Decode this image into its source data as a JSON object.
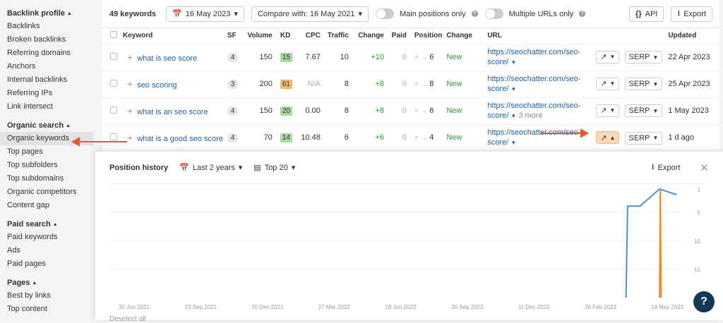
{
  "sidebar": {
    "sections": [
      {
        "title": "Backlink profile",
        "items": [
          "Backlinks",
          "Broken backlinks",
          "Referring domains",
          "Anchors",
          "Internal backlinks",
          "Referring IPs",
          "Link intersect"
        ]
      },
      {
        "title": "Organic search",
        "items": [
          "Organic keywords",
          "Top pages",
          "Top subfolders",
          "Top subdomains",
          "Organic competitors",
          "Content gap"
        ]
      },
      {
        "title": "Paid search",
        "items": [
          "Paid keywords",
          "Ads",
          "Paid pages"
        ]
      },
      {
        "title": "Pages",
        "items": [
          "Best by links",
          "Top content"
        ]
      }
    ],
    "active": "Organic keywords"
  },
  "toolbar": {
    "keyword_count": "49 keywords",
    "date": "16 May 2023",
    "compare": "Compare with: 16 May 2021",
    "main_positions_label": "Main positions only",
    "multiple_urls_label": "Multiple URLs only",
    "api_label": "API",
    "export_label": "Export"
  },
  "table": {
    "headers": {
      "keyword": "Keyword",
      "sf": "SF",
      "volume": "Volume",
      "kd": "KD",
      "cpc": "CPC",
      "traffic": "Traffic",
      "change": "Change",
      "paid": "Paid",
      "position": "Position",
      "change2": "Change",
      "url": "URL",
      "updated": "Updated"
    },
    "rows": [
      {
        "keyword": "what is seo score",
        "sf": "4",
        "volume": "150",
        "kd": "15",
        "kd_color": "green",
        "cpc": "7.67",
        "traffic": "10",
        "change": "+10",
        "paid": "0",
        "position": "6",
        "status": "New",
        "url": "https://seochatter.com/seo-score/",
        "more": "",
        "serp": "SERP",
        "updated": "22 Apr 2023"
      },
      {
        "keyword": "seo scoring",
        "sf": "3",
        "volume": "200",
        "kd": "61",
        "kd_color": "orange",
        "cpc": "N/A",
        "traffic": "8",
        "change": "+8",
        "paid": "0",
        "position": "8",
        "status": "New",
        "url": "https://seochatter.com/seo-score/",
        "more": "",
        "serp": "SERP",
        "updated": "25 Apr 2023"
      },
      {
        "keyword": "what is an seo score",
        "sf": "4",
        "volume": "150",
        "kd": "20",
        "kd_color": "green",
        "cpc": "0.00",
        "traffic": "8",
        "change": "+8",
        "paid": "0",
        "position": "6",
        "status": "New",
        "url": "https://seochatter.com/seo-score/",
        "more": "3 more",
        "serp": "SERP",
        "updated": "1 May 2023"
      },
      {
        "keyword": "what is a good seo score",
        "sf": "4",
        "volume": "70",
        "kd": "14",
        "kd_color": "green",
        "cpc": "10.48",
        "traffic": "6",
        "change": "+6",
        "paid": "0",
        "position": "4",
        "status": "New",
        "url": "https://seochatter.com/seo-score/",
        "more": "",
        "serp": "SERP",
        "updated": "1 d ago"
      }
    ]
  },
  "position_history": {
    "title": "Position history",
    "range": "Last 2 years",
    "top": "Top 20",
    "export_label": "Export",
    "footer_text": "Deselect all"
  },
  "chart_data": {
    "type": "line",
    "x_ticks": [
      "30 Jun 2021",
      "23 Sep 2021",
      "20 Dec 2021",
      "27 Mar 2022",
      "18 Jun 2022",
      "20 Sep 2022",
      "11 Dec 2022",
      "26 Feb 2023",
      "14 May 2023"
    ],
    "y_ticks": [
      "1",
      "5",
      "10",
      "15"
    ],
    "ylim": [
      1,
      20
    ],
    "y_inverted": true,
    "series": [
      {
        "color": "#4a90d9",
        "x": [
          "2023-03-10",
          "2023-03-12",
          "2023-03-28",
          "2023-04-22",
          "2023-05-14"
        ],
        "y": [
          20,
          4,
          4,
          1,
          2
        ]
      },
      {
        "color": "#f08a24",
        "x": [
          "2023-04-22",
          "2023-04-23",
          "2023-04-24"
        ],
        "y": [
          20,
          1,
          20
        ]
      }
    ]
  },
  "help_label": "?"
}
